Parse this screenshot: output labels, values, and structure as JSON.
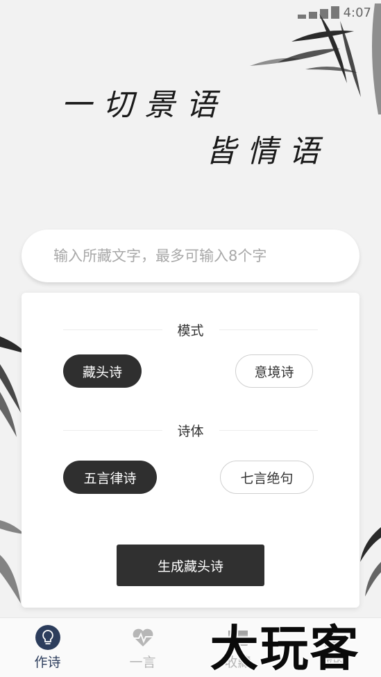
{
  "status": {
    "time": "4:07"
  },
  "hero": {
    "line1": "一切景语",
    "line2": "皆情语"
  },
  "search": {
    "placeholder": "输入所藏文字，最多可输入8个字"
  },
  "mode": {
    "title": "模式",
    "options": [
      "藏头诗",
      "意境诗"
    ],
    "selected": "藏头诗"
  },
  "form": {
    "title": "诗体",
    "options": [
      "五言律诗",
      "七言绝句"
    ],
    "selected": "五言律诗"
  },
  "generate_label": "生成藏头诗",
  "tabs": [
    {
      "label": "作诗",
      "icon": "lightbulb-icon",
      "active": true
    },
    {
      "label": "一言",
      "icon": "heart-pulse-icon",
      "active": false
    },
    {
      "label": "收藏",
      "icon": "folder-icon",
      "active": false
    },
    {
      "label": "我的",
      "icon": "user-icon",
      "active": false
    }
  ],
  "watermark": "大玩客",
  "colors": {
    "active_dark": "#2f2f2f",
    "tab_active": "#2c3d5c",
    "tab_inactive": "#b6b6b6"
  }
}
